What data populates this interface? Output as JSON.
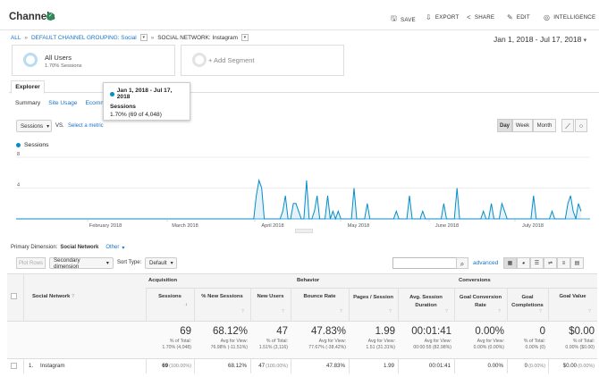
{
  "header": {
    "title": "Channels",
    "actions": [
      {
        "label": "SAVE",
        "icon": "save-icon",
        "glyph": "🖫"
      },
      {
        "label": "EXPORT",
        "icon": "export-icon",
        "glyph": "⇩"
      },
      {
        "label": "SHARE",
        "icon": "share-icon",
        "glyph": "<"
      },
      {
        "label": "EDIT",
        "icon": "edit-icon",
        "glyph": "✎"
      },
      {
        "label": "INTELLIGENCE",
        "icon": "intelligence-icon",
        "glyph": "◎"
      }
    ]
  },
  "breadcrumb": {
    "all": "ALL",
    "sep": "»",
    "grouping": "DEFAULT CHANNEL GROUPING: Social",
    "network": "SOCIAL NETWORK: Instagram"
  },
  "date_range": "Jan 1, 2018 - Jul 17, 2018",
  "segments": {
    "active_name": "All Users",
    "active_sub": "1.70% Sessions",
    "add_label": "+ Add Segment"
  },
  "tabs": {
    "explorer": "Explorer",
    "sub": [
      "Summary",
      "Site Usage",
      "Ecomm"
    ]
  },
  "tooltip": {
    "date": "Jan 1, 2018 - Jul 17, 2018",
    "metric": "Sessions",
    "value": "1.70% (69 of 4,048)"
  },
  "metric_controls": {
    "metric": "Sessions",
    "vs": "VS.",
    "select_metric": "Select a metric",
    "granularity": [
      "Day",
      "Week",
      "Month"
    ],
    "active_granularity": "Day"
  },
  "chart_data": {
    "type": "line",
    "series": [
      {
        "name": "Sessions",
        "color": "#058dc7"
      }
    ],
    "y_ticks": [
      "8",
      "4"
    ],
    "ylim": [
      0,
      8
    ],
    "x_labels": [
      "February 2018",
      "March 2018",
      "April 2018",
      "May 2018",
      "June 2018",
      "July 2018"
    ],
    "values": [
      0,
      0,
      0,
      0,
      0,
      0,
      0,
      0,
      0,
      0,
      0,
      0,
      0,
      0,
      0,
      0,
      0,
      0,
      0,
      0,
      0,
      0,
      0,
      0,
      0,
      0,
      0,
      0,
      0,
      0,
      0,
      0,
      0,
      0,
      0,
      0,
      0,
      0,
      0,
      0,
      0,
      0,
      0,
      0,
      0,
      0,
      0,
      0,
      0,
      0,
      0,
      0,
      0,
      0,
      0,
      0,
      0,
      0,
      0,
      0,
      0,
      0,
      0,
      0,
      0,
      0,
      0,
      0,
      0,
      0,
      0,
      0,
      0,
      0,
      0,
      0,
      0,
      0,
      0,
      0,
      0,
      0,
      0,
      0,
      0,
      0,
      0,
      0,
      0,
      0,
      0,
      3,
      5,
      4,
      0,
      0,
      0,
      0,
      0,
      0,
      0,
      1,
      3,
      0,
      0,
      2,
      2,
      1,
      0,
      0,
      5,
      0,
      0,
      1,
      3,
      0,
      0,
      0,
      3,
      0,
      1,
      0,
      1,
      0,
      0,
      0,
      0,
      0,
      4,
      0,
      0,
      0,
      0,
      2,
      0,
      0,
      0,
      0,
      0,
      0,
      0,
      0,
      0,
      0,
      1,
      0,
      0,
      0,
      0,
      3,
      0,
      0,
      0,
      0,
      1,
      0,
      0,
      0,
      0,
      0,
      0,
      0,
      2,
      0,
      0,
      0,
      0,
      4,
      0,
      0,
      0,
      0,
      0,
      0,
      0,
      0,
      0,
      1,
      0,
      0,
      2,
      0,
      0,
      0,
      2,
      1,
      0,
      0,
      0,
      0,
      0,
      0,
      0,
      0,
      0,
      0,
      3,
      0,
      0,
      0,
      0,
      0,
      0,
      1,
      0,
      0,
      0,
      0,
      0,
      2,
      3,
      1,
      0,
      2,
      1
    ]
  },
  "table_controls": {
    "primary_dimension_label": "Primary Dimension:",
    "primary_dimension": "Social Network",
    "other": "Other",
    "plot_rows": "Plot Rows",
    "secondary_dimension": "Secondary dimension",
    "sort_type_label": "Sort Type:",
    "sort_type": "Default",
    "advanced": "advanced"
  },
  "table": {
    "dimension_header": "Social Network",
    "groups": [
      "Acquisition",
      "Behavior",
      "Conversions"
    ],
    "columns": [
      "Sessions",
      "% New Sessions",
      "New Users",
      "Bounce Rate",
      "Pages / Session",
      "Avg. Session Duration",
      "Goal Conversion Rate",
      "Goal Completions",
      "Goal Value"
    ],
    "summary": [
      {
        "big": "69",
        "sub1": "% of Total:",
        "sub2": "1.70% (4,048)"
      },
      {
        "big": "68.12%",
        "sub1": "Avg for View:",
        "sub2": "76.98% (-11.51%)"
      },
      {
        "big": "47",
        "sub1": "% of Total:",
        "sub2": "1.51% (3,116)"
      },
      {
        "big": "47.83%",
        "sub1": "Avg for View:",
        "sub2": "77.67% (-38.42%)"
      },
      {
        "big": "1.99",
        "sub1": "Avg for View:",
        "sub2": "1.51 (31.31%)"
      },
      {
        "big": "00:01:41",
        "sub1": "Avg for View:",
        "sub2": "00:00:55 (82.98%)"
      },
      {
        "big": "0.00%",
        "sub1": "Avg for View:",
        "sub2": "0.00% (0.00%)"
      },
      {
        "big": "0",
        "sub1": "% of Total:",
        "sub2": "0.00% (0)"
      },
      {
        "big": "$0.00",
        "sub1": "% of Total:",
        "sub2": "0.00% ($0.00)"
      }
    ],
    "rows": [
      {
        "index": "1.",
        "name": "Instagram",
        "cells": [
          {
            "v": "69",
            "p": "(100.00%)"
          },
          {
            "v": "68.12%",
            "p": ""
          },
          {
            "v": "47",
            "p": "(100.00%)"
          },
          {
            "v": "47.83%",
            "p": ""
          },
          {
            "v": "1.99",
            "p": ""
          },
          {
            "v": "00:01:41",
            "p": ""
          },
          {
            "v": "0.00%",
            "p": ""
          },
          {
            "v": "0",
            "p": "(0.00%)"
          },
          {
            "v": "$0.00",
            "p": "(0.00%)"
          }
        ]
      }
    ]
  }
}
